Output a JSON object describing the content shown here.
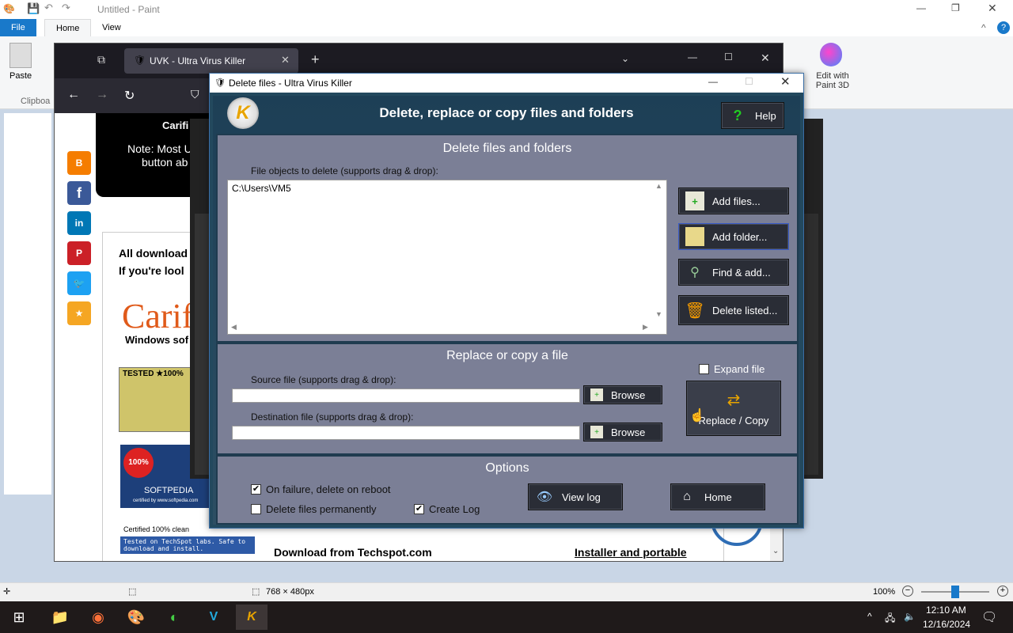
{
  "paint": {
    "title": "Untitled - Paint",
    "tabs": [
      "File",
      "Home",
      "View"
    ],
    "paste_label": "Paste",
    "clipboard_label": "Clipboa",
    "edit3d_label": "Edit with Paint 3D",
    "status_size": "768 × 480px",
    "zoom": "100%"
  },
  "browser": {
    "tab_title": "UVK - Ultra Virus Killer",
    "page": {
      "banner_title": "Carifi",
      "banner_note_1": "Note: Most U",
      "banner_note_2": "button ab",
      "all_download": "All download",
      "if_looking": "If you're lool",
      "windows_soft": "Windows sof",
      "tested": "TESTED ★100%",
      "softpedia": "SOFTPEDIA",
      "softpedia_cert": "certified by www.softpedia.com",
      "certified_clean": "Certified 100% clean",
      "techspot_note": "Tested on TechSpot labs. Safe to download and install.",
      "download_from": "Download from Techspot.com",
      "installer": "Installer and portable"
    }
  },
  "dialog": {
    "title": "Delete files - Ultra Virus Killer",
    "header": "Delete, replace or copy files and folders",
    "help": "Help",
    "delete_section": {
      "title": "Delete files and folders",
      "list_label": "File objects to delete (supports drag & drop):",
      "items": [
        "C:\\Users\\VM5"
      ],
      "buttons": [
        "Add files...",
        "Add folder...",
        "Find & add...",
        "Delete listed..."
      ]
    },
    "replace_section": {
      "title": "Replace or copy a file",
      "source_label": "Source file (supports drag & drop):",
      "dest_label": "Destination file (supports drag & drop):",
      "browse": "Browse",
      "expand_label": "Expand file",
      "replace_label": "Replace / Copy"
    },
    "options_section": {
      "title": "Options",
      "on_failure": "On failure, delete on reboot",
      "permanent": "Delete files permanently",
      "create_log": "Create Log",
      "view_log": "View log",
      "home": "Home"
    }
  },
  "taskbar": {
    "time": "12:10 AM",
    "date": "12/16/2024"
  }
}
